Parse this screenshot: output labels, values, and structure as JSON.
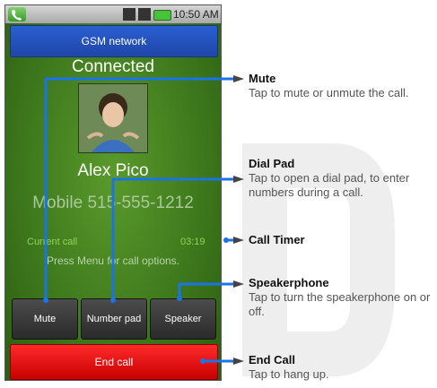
{
  "status_bar": {
    "time": "10:50 AM"
  },
  "network": {
    "label": "GSM network"
  },
  "call": {
    "status": "Connected",
    "caller_name": "Alex Pico",
    "caller_number": "Mobile 515-555-1212",
    "timer_label": "Current call",
    "timer_value": "03:19",
    "hint": "Press Menu for call options."
  },
  "buttons": {
    "mute": "Mute",
    "number_pad": "Number pad",
    "speaker": "Speaker",
    "end_call": "End call"
  },
  "annotations": [
    {
      "title": "Mute",
      "desc": "Tap to mute or unmute the call."
    },
    {
      "title": "Dial Pad",
      "desc": "Tap to open a dial pad, to enter numbers during a call."
    },
    {
      "title": "Call Timer",
      "desc": ""
    },
    {
      "title": "Speakerphone",
      "desc": "Tap to turn the speakerphone on or off."
    },
    {
      "title": "End Call",
      "desc": "Tap to hang up."
    }
  ],
  "colors": {
    "screen_green": "#3f7a1d",
    "network_blue": "#1f46a8",
    "end_call_red": "#e00000",
    "timer_green": "#8fd45b",
    "callout_line": "#1a73e8"
  },
  "icons": [
    "phone-app-icon",
    "signal-icon",
    "battery-icon",
    "contact-photo"
  ]
}
